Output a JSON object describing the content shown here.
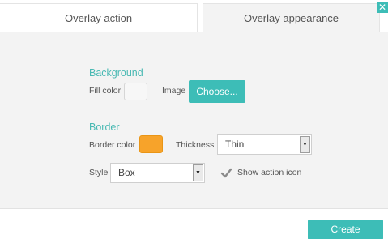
{
  "tabs": [
    {
      "label": "Overlay action",
      "active": false
    },
    {
      "label": "Overlay appearance",
      "active": true
    }
  ],
  "close_icon": "close-icon",
  "background": {
    "title": "Background",
    "fill_color_label": "Fill color",
    "fill_color": "#f7f7f7",
    "image_label": "Image",
    "choose_label": "Choose..."
  },
  "border": {
    "title": "Border",
    "border_color_label": "Border color",
    "border_color": "#f7a32a",
    "thickness_label": "Thickness",
    "thickness_value": "Thin",
    "style_label": "Style",
    "style_value": "Box",
    "show_action_icon_label": "Show action icon",
    "show_action_icon_checked": true
  },
  "footer": {
    "create_label": "Create"
  },
  "colors": {
    "accent": "#3dbdb7",
    "section_title": "#49b9b3",
    "panel_bg": "#f3f3f3"
  }
}
